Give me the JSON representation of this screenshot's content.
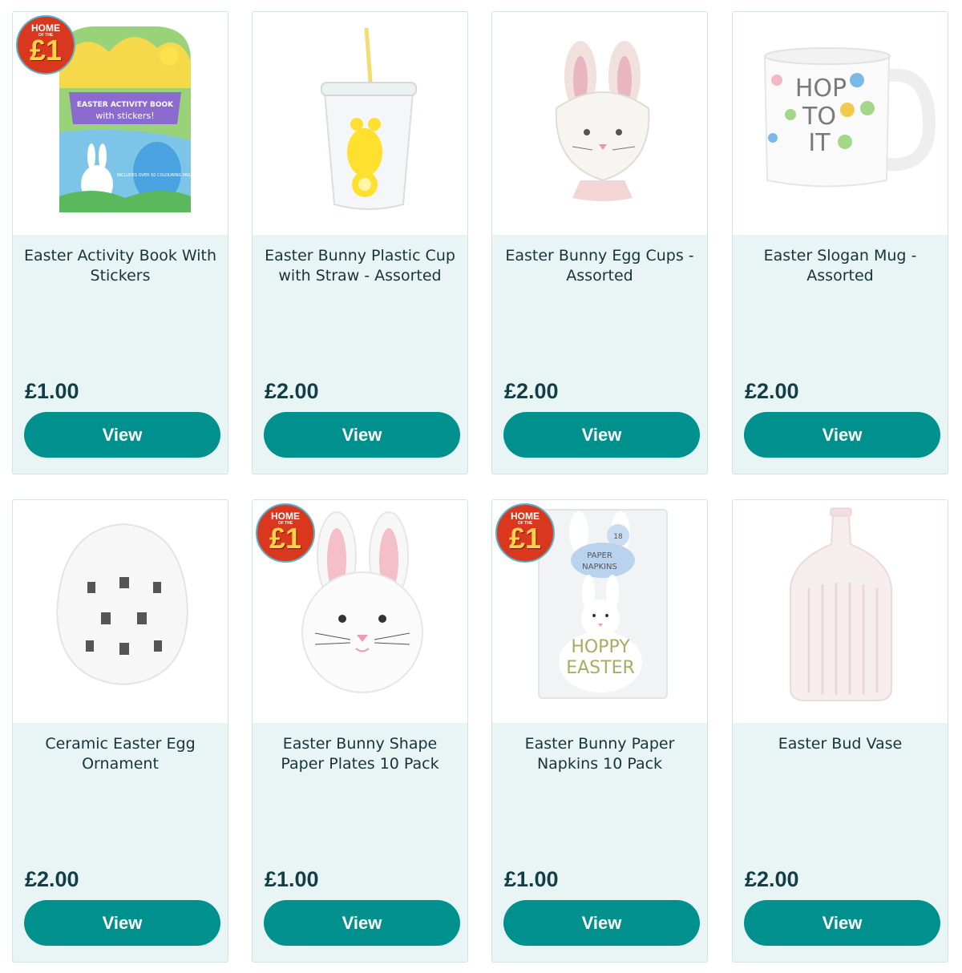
{
  "badge": {
    "line1": "HOME",
    "line2": "OF THE",
    "line3": "£1"
  },
  "products": [
    {
      "title": "Easter Activity Book With Stickers",
      "price": "£1.00",
      "button": "View",
      "image_text": [
        "EASTER ACTIVITY BOOK",
        "with stickers!",
        "INCLUDES OVER 50 COLOURING PAGES!"
      ]
    },
    {
      "title": "Easter Bunny Plastic Cup with Straw - Assorted",
      "price": "£2.00",
      "button": "View"
    },
    {
      "title": "Easter Bunny Egg Cups - Assorted",
      "price": "£2.00",
      "button": "View"
    },
    {
      "title": "Easter Slogan Mug - Assorted",
      "price": "£2.00",
      "button": "View",
      "image_text": [
        "HOP",
        "TO",
        "IT"
      ]
    },
    {
      "title": "Ceramic Easter Egg Ornament",
      "price": "£2.00",
      "button": "View"
    },
    {
      "title": "Easter Bunny Shape Paper Plates 10 Pack",
      "price": "£1.00",
      "button": "View"
    },
    {
      "title": "Easter Bunny Paper Napkins 10 Pack",
      "price": "£1.00",
      "button": "View",
      "image_text": [
        "PAPER",
        "NAPKINS",
        "HOPPY",
        "EASTER",
        "18"
      ]
    },
    {
      "title": "Easter Bud Vase",
      "price": "£2.00",
      "button": "View"
    }
  ],
  "colors": {
    "button": "#00918e",
    "card_bg": "#e9f5f5",
    "price": "#123e46",
    "badge": "#d9381e"
  }
}
